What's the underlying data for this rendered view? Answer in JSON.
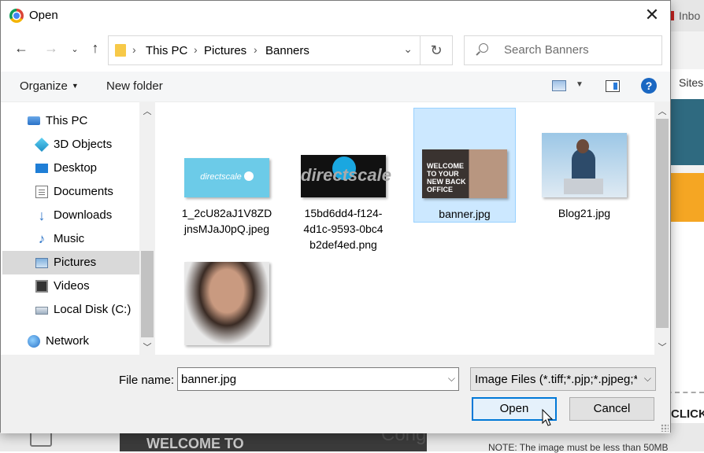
{
  "background": {
    "tab_label": "Inbo",
    "side_label": "Sites",
    "click_label": "CLICK",
    "image_text": "WELCOME TO",
    "heading_fragment": "Cong",
    "note": "NOTE: The image must be less than 50MB"
  },
  "dialog": {
    "title": "Open",
    "breadcrumb": [
      "This PC",
      "Pictures",
      "Banners"
    ],
    "search_placeholder": "Search Banners",
    "toolbar": {
      "organize": "Organize",
      "new_folder": "New folder",
      "help": "?"
    },
    "nav_items": [
      {
        "label": "This PC",
        "icon": "pc-icon"
      },
      {
        "label": "3D Objects",
        "icon": "3d-objects-icon"
      },
      {
        "label": "Desktop",
        "icon": "desktop-icon"
      },
      {
        "label": "Documents",
        "icon": "documents-icon"
      },
      {
        "label": "Downloads",
        "icon": "downloads-icon"
      },
      {
        "label": "Music",
        "icon": "music-icon"
      },
      {
        "label": "Pictures",
        "icon": "pictures-icon",
        "selected": true
      },
      {
        "label": "Videos",
        "icon": "videos-icon"
      },
      {
        "label": "Local Disk (C:)",
        "icon": "disk-icon"
      },
      {
        "label": "Network",
        "icon": "network-icon"
      }
    ],
    "files": [
      {
        "name_line1": "1_2cU82aJ1V8ZD",
        "name_line2": "jnsMJaJ0pQ.jpeg",
        "name_line3": "",
        "thumb_text": "directscale"
      },
      {
        "name_line1": "15bd6dd4-f124-",
        "name_line2": "4d1c-9593-0bc4",
        "name_line3": "b2def4ed.png",
        "thumb_text": "directscale"
      },
      {
        "name_line1": "banner.jpg",
        "name_line2": "",
        "name_line3": "",
        "thumb_text": "WELCOME TO YOUR NEW BACK OFFICE",
        "selected": true
      },
      {
        "name_line1": "Blog21.jpg",
        "name_line2": "",
        "name_line3": "",
        "thumb_text": ""
      },
      {
        "name_line1": "",
        "name_line2": "",
        "name_line3": "",
        "thumb_text": ""
      }
    ],
    "file_name_label": "File name:",
    "file_name_value": "banner.jpg",
    "file_type": "Image Files (*.tiff;*.pjp;*.pjpeg;*",
    "open_button": "Open",
    "cancel_button": "Cancel",
    "colors": {
      "accent": "#0078d7",
      "selection": "#cce8ff",
      "nav_selected": "#d9d9d9"
    }
  }
}
